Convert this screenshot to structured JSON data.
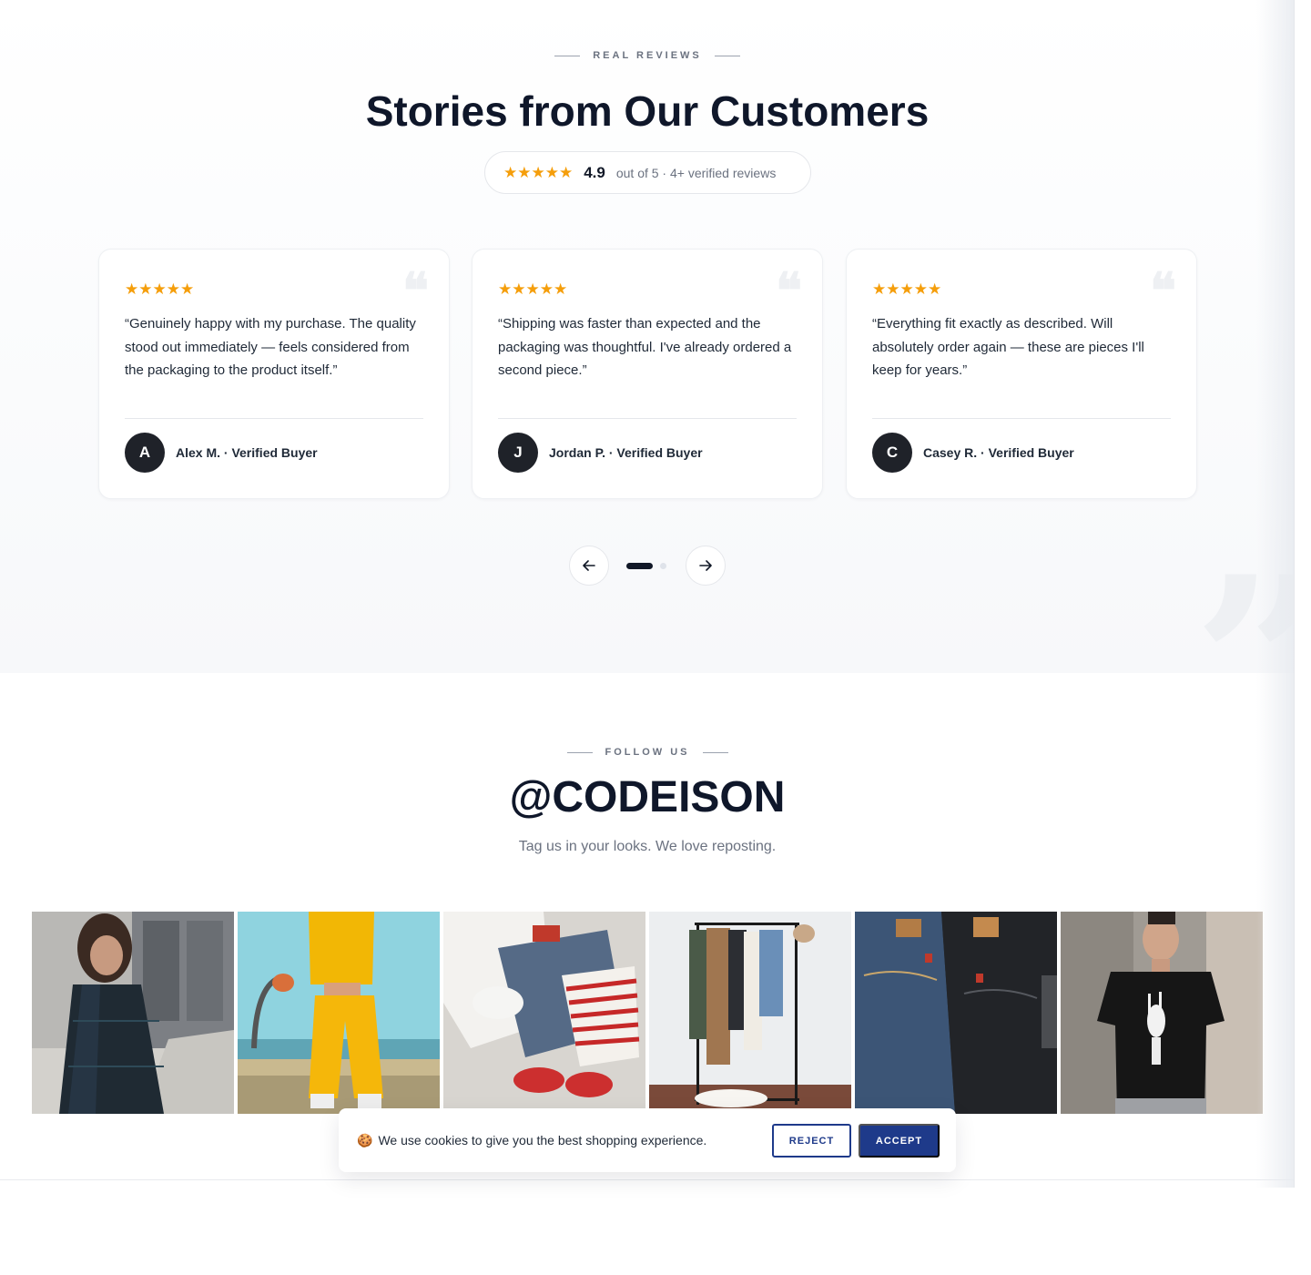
{
  "reviews_section": {
    "eyebrow": "REAL REVIEWS",
    "title": "Stories from Our Customers",
    "rating": {
      "stars": "★★★★★",
      "score": "4.9",
      "text": "out of 5 · 4+ verified reviews",
      "star_color": "#f59e0b"
    },
    "cards": [
      {
        "stars": "★★★★★",
        "quote_mark": "❝",
        "quote": "“Genuinely happy with my purchase. The quality stood out immediately — feels considered from the packaging to the product itself.”",
        "avatar_letter": "A",
        "author": "Alex M. · Verified Buyer"
      },
      {
        "stars": "★★★★★",
        "quote_mark": "❝",
        "quote": "“Shipping was faster than expected and the packaging was thoughtful. I've already ordered a second piece.”",
        "avatar_letter": "J",
        "author": "Jordan P. · Verified Buyer"
      },
      {
        "stars": "★★★★★",
        "quote_mark": "❝",
        "quote": "“Everything fit exactly as described. Will absolutely order again — these are pieces I'll keep for years.”",
        "avatar_letter": "C",
        "author": "Casey R. · Verified Buyer"
      }
    ],
    "carousel": {
      "prev_icon": "arrow-left-icon",
      "next_icon": "arrow-right-icon",
      "current_page": 1,
      "page_count": 2
    }
  },
  "follow_section": {
    "eyebrow": "FOLLOW US",
    "handle": "@CODEISON",
    "tagline": "Tag us in your looks. We love reposting.",
    "gallery": [
      "woman-in-plaid-coat-photo",
      "yellow-tracksuit-photo",
      "clothing-flatlay-photo",
      "clothing-rack-photo",
      "denim-jeans-photo",
      "man-in-skeleton-tshirt-photo"
    ]
  },
  "cookie_banner": {
    "icon": "🍪",
    "text": "We use cookies to give you the best shopping experience.",
    "reject_label": "REJECT",
    "accept_label": "ACCEPT",
    "accent_color": "#1e3a8a"
  }
}
